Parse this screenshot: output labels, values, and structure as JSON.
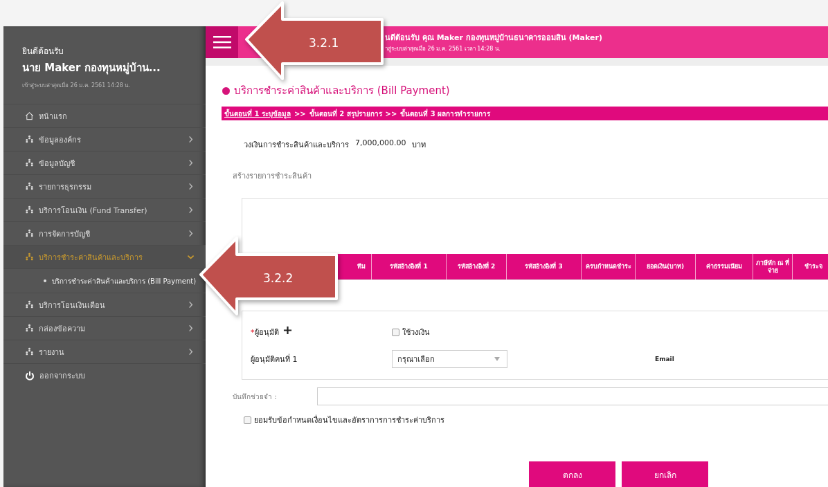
{
  "sidebar": {
    "greeting": "ยินดีต้อนรับ",
    "user_name": "นาย Maker กองทุนหมู่บ้าน...",
    "last_login": "เข้าสู่ระบบล่าสุดเมื่อ 26 ม.ค. 2561 14:28 น.",
    "items": [
      {
        "kind": "home",
        "label": "หน้าแรก",
        "expanded": false
      },
      {
        "kind": "group",
        "label": "ข้อมูลองค์กร",
        "expanded": false
      },
      {
        "kind": "group",
        "label": "ข้อมูลบัญชี",
        "expanded": false
      },
      {
        "kind": "group",
        "label": "รายการธุรกรรม",
        "expanded": false
      },
      {
        "kind": "group",
        "label": "บริการโอนเงิน (Fund Transfer)",
        "expanded": false
      },
      {
        "kind": "group",
        "label": "การจัดการบัญชี",
        "expanded": false
      },
      {
        "kind": "group",
        "label": "บริการชำระค่าสินค้าและบริการ",
        "expanded": true,
        "children": [
          {
            "label": "บริการชำระค่าสินค้าและบริการ (Bill Payment)"
          }
        ]
      },
      {
        "kind": "group",
        "label": "บริการโอนเงินเดือน",
        "expanded": false
      },
      {
        "kind": "group",
        "label": "กล่องข้อความ",
        "expanded": false
      },
      {
        "kind": "group",
        "label": "รายงาน",
        "expanded": false
      },
      {
        "kind": "logout",
        "label": "ออกจากระบบ",
        "expanded": false
      }
    ]
  },
  "header": {
    "welcome": "นดีต้อนรับ คุณ Maker กองทุนหมู่บ้านธนาคารออมสิน (Maker)",
    "last_login": "าสู่ระบบล่าสุดเมื่อ 26 ม.ค. 2561 เวลา 14:28 น."
  },
  "page_title": "บริการชำระค่าสินค้าและบริการ (Bill Payment)",
  "steps": [
    {
      "label": "ขั้นตอนที่ 1 ระบุข้อมูล",
      "selected": true,
      "next": ">>"
    },
    {
      "label": "ขั้นตอนที่ 2 สรุปรายการ",
      "selected": false,
      "next": ">>"
    },
    {
      "label": "ขั้นตอนที่ 3 ผลการทำรายการ",
      "selected": false
    }
  ],
  "credit_limit": {
    "label": "วงเงินการชำระสินค้าและบริการ",
    "amount": "7,000,000.00",
    "unit": "บาท"
  },
  "items_section": {
    "label": "สร้างรายการชำระสินค้า",
    "columns": [
      "ทีม",
      "รหัสอ้างอิงที่ 1",
      "รหัสอ้างอิงที่ 2",
      "รหัสอ้างอิงที่ 3",
      "ครบกำหนดชำระ",
      "ยอดเงิน(บาท)",
      "ค่าธรรมเนียม",
      "ภาษีหัก ณ ที่จ่าย",
      "ชำระจ"
    ]
  },
  "approvers": {
    "required_mark": "*",
    "label": "ผู้อนุมัติ",
    "use_limit": {
      "label": "ใช้วงเงิน",
      "checked": false
    },
    "rows": [
      {
        "label": "ผู้อนุมัติคนที่ 1",
        "placeholder": "กรุณาเลือก",
        "email_label": "Email"
      }
    ]
  },
  "memo": {
    "label": "บันทึกช่วยจำ :"
  },
  "accept_terms": {
    "label": "ยอมรับข้อกำหนดเงื่อนไขและอัตราการการชำระค่าบริการ",
    "checked": false
  },
  "buttons": [
    "ตกลง",
    "ยกเลิก"
  ],
  "callouts": [
    {
      "label": "3.2.1"
    },
    {
      "label": "3.2.2"
    }
  ]
}
